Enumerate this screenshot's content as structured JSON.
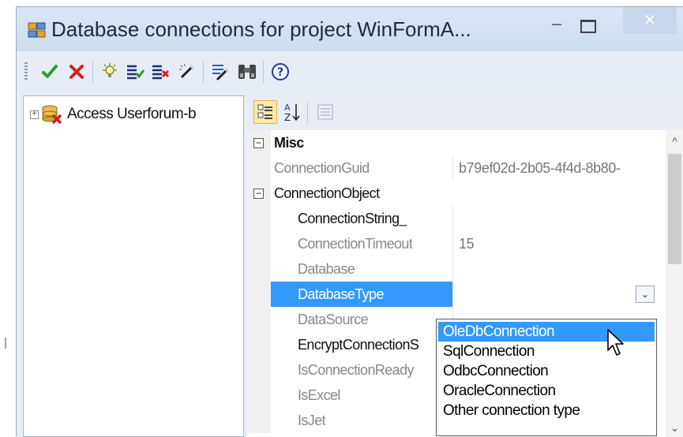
{
  "window": {
    "title": "Database connections for project WinFormA...",
    "minimize_glyph": "–",
    "close_glyph": "✕"
  },
  "toolbar": {
    "buttons": [
      {
        "name": "accept-icon"
      },
      {
        "name": "delete-icon"
      },
      {
        "name": "add-connection-icon"
      },
      {
        "name": "enable-all-icon"
      },
      {
        "name": "disable-all-icon"
      },
      {
        "name": "wizard-icon"
      },
      {
        "name": "settings-wizard-icon"
      },
      {
        "name": "binoculars-icon"
      },
      {
        "name": "help-icon"
      }
    ]
  },
  "tree": {
    "nodes": [
      {
        "label": "Access Userforum-b",
        "expander": "+"
      }
    ]
  },
  "property_grid": {
    "toolbar": [
      {
        "name": "categorized-icon",
        "active": true
      },
      {
        "name": "alphabetical-icon",
        "label_a": "A",
        "label_z": "Z"
      },
      {
        "name": "property-pages-icon",
        "active": false
      }
    ],
    "rows": [
      {
        "type": "category",
        "toggle": "−",
        "name": "Misc"
      },
      {
        "type": "prop",
        "name": "ConnectionGuid",
        "value": "b79ef02d-2b05-4f4d-8b80-",
        "style": "grey"
      },
      {
        "type": "subcategory",
        "toggle": "−",
        "name": "ConnectionObject"
      },
      {
        "type": "prop",
        "name": "ConnectionString_",
        "value": "",
        "style": "black"
      },
      {
        "type": "prop",
        "name": "ConnectionTimeout",
        "value": "15",
        "style": "grey"
      },
      {
        "type": "prop",
        "name": "Database",
        "value": "",
        "style": "grey"
      },
      {
        "type": "prop",
        "name": "DatabaseType",
        "value": "",
        "style": "selected"
      },
      {
        "type": "prop",
        "name": "DataSource",
        "value": "",
        "style": "grey"
      },
      {
        "type": "prop",
        "name": "EncryptConnectionS",
        "value": "",
        "style": "black"
      },
      {
        "type": "prop",
        "name": "IsConnectionReady",
        "value": "",
        "style": "grey"
      },
      {
        "type": "prop",
        "name": "IsExcel",
        "value": "",
        "style": "grey"
      },
      {
        "type": "prop",
        "name": "IsJet",
        "value": "",
        "style": "grey"
      }
    ],
    "dropdown_glyph": "⌄",
    "scroll_up": "^",
    "scroll_down": "⌄"
  },
  "dropdown": {
    "options": [
      "OleDbConnection",
      "SqlConnection",
      "OdbcConnection",
      "OracleConnection",
      "Other connection type"
    ],
    "highlighted_index": 0
  },
  "colors": {
    "selection": "#3399ff",
    "accept_green": "#2e9e2e",
    "delete_red": "#d42020"
  }
}
